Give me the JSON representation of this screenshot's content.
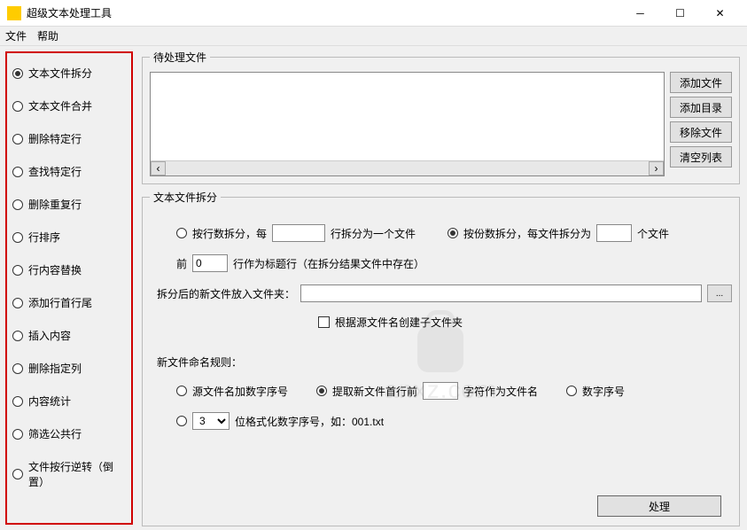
{
  "window": {
    "title": "超级文本处理工具"
  },
  "menu": {
    "file": "文件",
    "help": "帮助"
  },
  "sidebar": {
    "items": [
      {
        "label": "文本文件拆分",
        "selected": true
      },
      {
        "label": "文本文件合并",
        "selected": false
      },
      {
        "label": "删除特定行",
        "selected": false
      },
      {
        "label": "查找特定行",
        "selected": false
      },
      {
        "label": "删除重复行",
        "selected": false
      },
      {
        "label": "行排序",
        "selected": false
      },
      {
        "label": "行内容替换",
        "selected": false
      },
      {
        "label": "添加行首行尾",
        "selected": false
      },
      {
        "label": "插入内容",
        "selected": false
      },
      {
        "label": "删除指定列",
        "selected": false
      },
      {
        "label": "内容统计",
        "selected": false
      },
      {
        "label": "筛选公共行",
        "selected": false
      },
      {
        "label": "文件按行逆转（倒置）",
        "selected": false
      }
    ]
  },
  "filebox": {
    "legend": "待处理文件",
    "buttons": {
      "add_file": "添加文件",
      "add_dir": "添加目录",
      "remove": "移除文件",
      "clear": "清空列表"
    }
  },
  "split": {
    "legend": "文本文件拆分",
    "by_lines": {
      "pre": "按行数拆分，每",
      "post": "行拆分为一个文件",
      "value": ""
    },
    "by_count": {
      "pre": "按份数拆分，每文件拆分为",
      "post": "个文件",
      "value": ""
    },
    "header": {
      "pre": "前",
      "post": "行作为标题行（在拆分结果文件中存在）",
      "value": "0"
    },
    "outdir": {
      "label": "拆分后的新文件放入文件夹：",
      "value": "",
      "browse": "..."
    },
    "subdir": {
      "label": "根据源文件名创建子文件夹"
    },
    "naming": {
      "label": "新文件命名规则：",
      "opt1": "源文件名加数字序号",
      "opt2_pre": "提取新文件首行前",
      "opt2_post": "字符作为文件名",
      "opt2_val": "",
      "opt3": "数字序号",
      "fmt_digits": "3",
      "fmt_post": "位格式化数字序号，如：001.txt"
    }
  },
  "process_btn": "处理",
  "watermark": "anxz.com"
}
